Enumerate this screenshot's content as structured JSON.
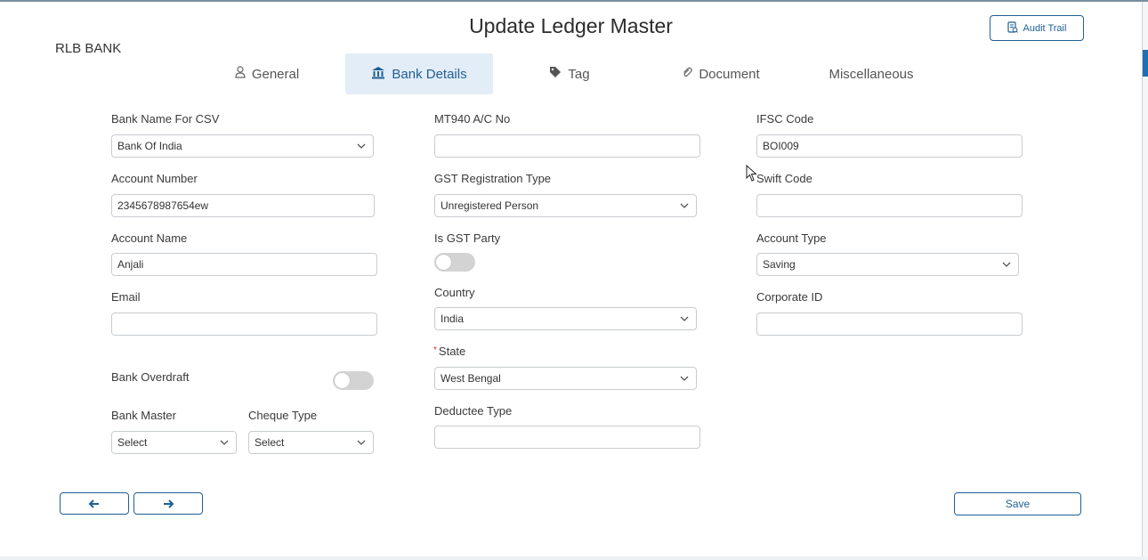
{
  "header": {
    "title": "Update Ledger Master",
    "company": "RLB BANK",
    "audit_trail_label": "Audit Trail"
  },
  "tabs": [
    {
      "label": "General",
      "icon": "user-icon",
      "active": false
    },
    {
      "label": "Bank Details",
      "icon": "bank-icon",
      "active": true
    },
    {
      "label": "Tag",
      "icon": "tag-icon",
      "active": false
    },
    {
      "label": "Document",
      "icon": "paperclip-icon",
      "active": false
    },
    {
      "label": "Miscellaneous",
      "icon": "",
      "active": false
    }
  ],
  "form": {
    "bank_name_csv": {
      "label": "Bank Name For CSV",
      "value": "Bank Of India"
    },
    "account_number": {
      "label": "Account Number",
      "value": "2345678987654ew"
    },
    "account_name": {
      "label": "Account Name",
      "value": "Anjali"
    },
    "email": {
      "label": "Email",
      "value": ""
    },
    "bank_overdraft": {
      "label": "Bank Overdraft",
      "on": false
    },
    "bank_master": {
      "label": "Bank Master",
      "value": "Select"
    },
    "cheque_type": {
      "label": "Cheque Type",
      "value": "Select"
    },
    "mt940": {
      "label": "MT940 A/C No",
      "value": ""
    },
    "gst_registration_type": {
      "label": "GST Registration Type",
      "value": "Unregistered Person"
    },
    "is_gst_party": {
      "label": "Is GST Party",
      "on": false
    },
    "country": {
      "label": "Country",
      "value": "India"
    },
    "state": {
      "label": "State",
      "value": "West Bengal",
      "required_mark": "*"
    },
    "deductee_type": {
      "label": "Deductee Type",
      "value": ""
    },
    "ifsc_code": {
      "label": "IFSC Code",
      "value": "BOI009"
    },
    "swift_code": {
      "label": "Swift Code",
      "value": ""
    },
    "account_type": {
      "label": "Account Type",
      "value": "Saving"
    },
    "corporate_id": {
      "label": "Corporate ID",
      "value": ""
    }
  },
  "footer": {
    "save_label": "Save"
  },
  "colors": {
    "accent": "#1f5f95",
    "active_tab_bg": "#e3edf7",
    "toggle_off": "#d3d3d3"
  }
}
